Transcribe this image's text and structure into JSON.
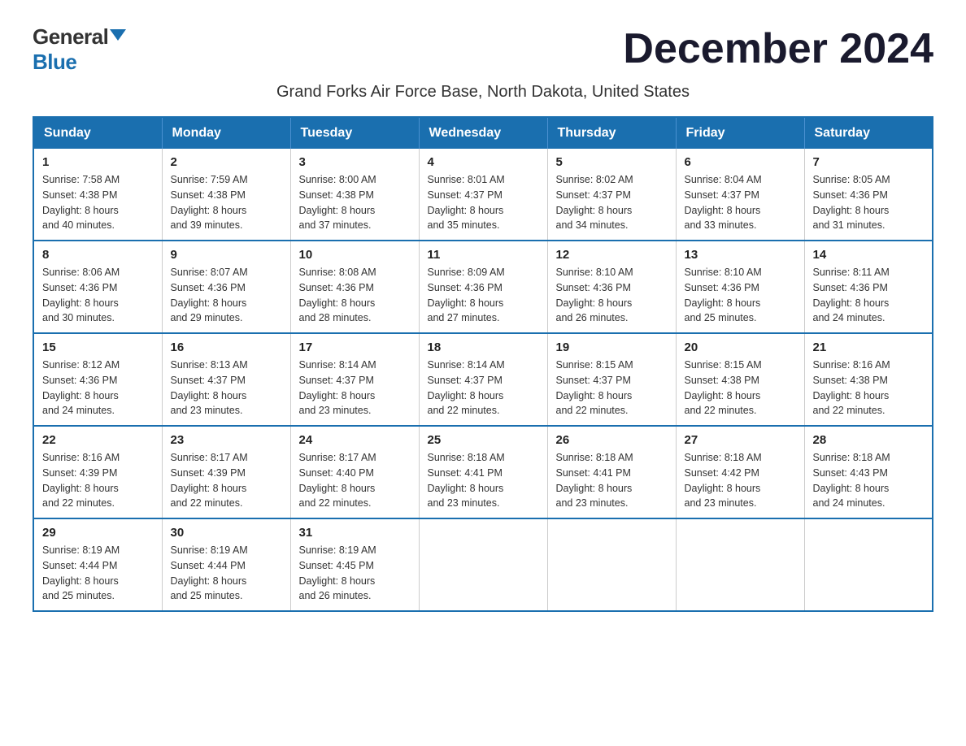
{
  "logo": {
    "general": "General",
    "blue": "Blue"
  },
  "title": "December 2024",
  "subtitle": "Grand Forks Air Force Base, North Dakota, United States",
  "headers": [
    "Sunday",
    "Monday",
    "Tuesday",
    "Wednesday",
    "Thursday",
    "Friday",
    "Saturday"
  ],
  "weeks": [
    [
      {
        "day": "1",
        "sunrise": "7:58 AM",
        "sunset": "4:38 PM",
        "daylight": "8 hours and 40 minutes."
      },
      {
        "day": "2",
        "sunrise": "7:59 AM",
        "sunset": "4:38 PM",
        "daylight": "8 hours and 39 minutes."
      },
      {
        "day": "3",
        "sunrise": "8:00 AM",
        "sunset": "4:38 PM",
        "daylight": "8 hours and 37 minutes."
      },
      {
        "day": "4",
        "sunrise": "8:01 AM",
        "sunset": "4:37 PM",
        "daylight": "8 hours and 35 minutes."
      },
      {
        "day": "5",
        "sunrise": "8:02 AM",
        "sunset": "4:37 PM",
        "daylight": "8 hours and 34 minutes."
      },
      {
        "day": "6",
        "sunrise": "8:04 AM",
        "sunset": "4:37 PM",
        "daylight": "8 hours and 33 minutes."
      },
      {
        "day": "7",
        "sunrise": "8:05 AM",
        "sunset": "4:36 PM",
        "daylight": "8 hours and 31 minutes."
      }
    ],
    [
      {
        "day": "8",
        "sunrise": "8:06 AM",
        "sunset": "4:36 PM",
        "daylight": "8 hours and 30 minutes."
      },
      {
        "day": "9",
        "sunrise": "8:07 AM",
        "sunset": "4:36 PM",
        "daylight": "8 hours and 29 minutes."
      },
      {
        "day": "10",
        "sunrise": "8:08 AM",
        "sunset": "4:36 PM",
        "daylight": "8 hours and 28 minutes."
      },
      {
        "day": "11",
        "sunrise": "8:09 AM",
        "sunset": "4:36 PM",
        "daylight": "8 hours and 27 minutes."
      },
      {
        "day": "12",
        "sunrise": "8:10 AM",
        "sunset": "4:36 PM",
        "daylight": "8 hours and 26 minutes."
      },
      {
        "day": "13",
        "sunrise": "8:10 AM",
        "sunset": "4:36 PM",
        "daylight": "8 hours and 25 minutes."
      },
      {
        "day": "14",
        "sunrise": "8:11 AM",
        "sunset": "4:36 PM",
        "daylight": "8 hours and 24 minutes."
      }
    ],
    [
      {
        "day": "15",
        "sunrise": "8:12 AM",
        "sunset": "4:36 PM",
        "daylight": "8 hours and 24 minutes."
      },
      {
        "day": "16",
        "sunrise": "8:13 AM",
        "sunset": "4:37 PM",
        "daylight": "8 hours and 23 minutes."
      },
      {
        "day": "17",
        "sunrise": "8:14 AM",
        "sunset": "4:37 PM",
        "daylight": "8 hours and 23 minutes."
      },
      {
        "day": "18",
        "sunrise": "8:14 AM",
        "sunset": "4:37 PM",
        "daylight": "8 hours and 22 minutes."
      },
      {
        "day": "19",
        "sunrise": "8:15 AM",
        "sunset": "4:37 PM",
        "daylight": "8 hours and 22 minutes."
      },
      {
        "day": "20",
        "sunrise": "8:15 AM",
        "sunset": "4:38 PM",
        "daylight": "8 hours and 22 minutes."
      },
      {
        "day": "21",
        "sunrise": "8:16 AM",
        "sunset": "4:38 PM",
        "daylight": "8 hours and 22 minutes."
      }
    ],
    [
      {
        "day": "22",
        "sunrise": "8:16 AM",
        "sunset": "4:39 PM",
        "daylight": "8 hours and 22 minutes."
      },
      {
        "day": "23",
        "sunrise": "8:17 AM",
        "sunset": "4:39 PM",
        "daylight": "8 hours and 22 minutes."
      },
      {
        "day": "24",
        "sunrise": "8:17 AM",
        "sunset": "4:40 PM",
        "daylight": "8 hours and 22 minutes."
      },
      {
        "day": "25",
        "sunrise": "8:18 AM",
        "sunset": "4:41 PM",
        "daylight": "8 hours and 23 minutes."
      },
      {
        "day": "26",
        "sunrise": "8:18 AM",
        "sunset": "4:41 PM",
        "daylight": "8 hours and 23 minutes."
      },
      {
        "day": "27",
        "sunrise": "8:18 AM",
        "sunset": "4:42 PM",
        "daylight": "8 hours and 23 minutes."
      },
      {
        "day": "28",
        "sunrise": "8:18 AM",
        "sunset": "4:43 PM",
        "daylight": "8 hours and 24 minutes."
      }
    ],
    [
      {
        "day": "29",
        "sunrise": "8:19 AM",
        "sunset": "4:44 PM",
        "daylight": "8 hours and 25 minutes."
      },
      {
        "day": "30",
        "sunrise": "8:19 AM",
        "sunset": "4:44 PM",
        "daylight": "8 hours and 25 minutes."
      },
      {
        "day": "31",
        "sunrise": "8:19 AM",
        "sunset": "4:45 PM",
        "daylight": "8 hours and 26 minutes."
      },
      null,
      null,
      null,
      null
    ]
  ],
  "labels": {
    "sunrise": "Sunrise:",
    "sunset": "Sunset:",
    "daylight": "Daylight:"
  },
  "colors": {
    "header_bg": "#1a6faf",
    "header_text": "#ffffff",
    "border": "#1a6faf"
  }
}
